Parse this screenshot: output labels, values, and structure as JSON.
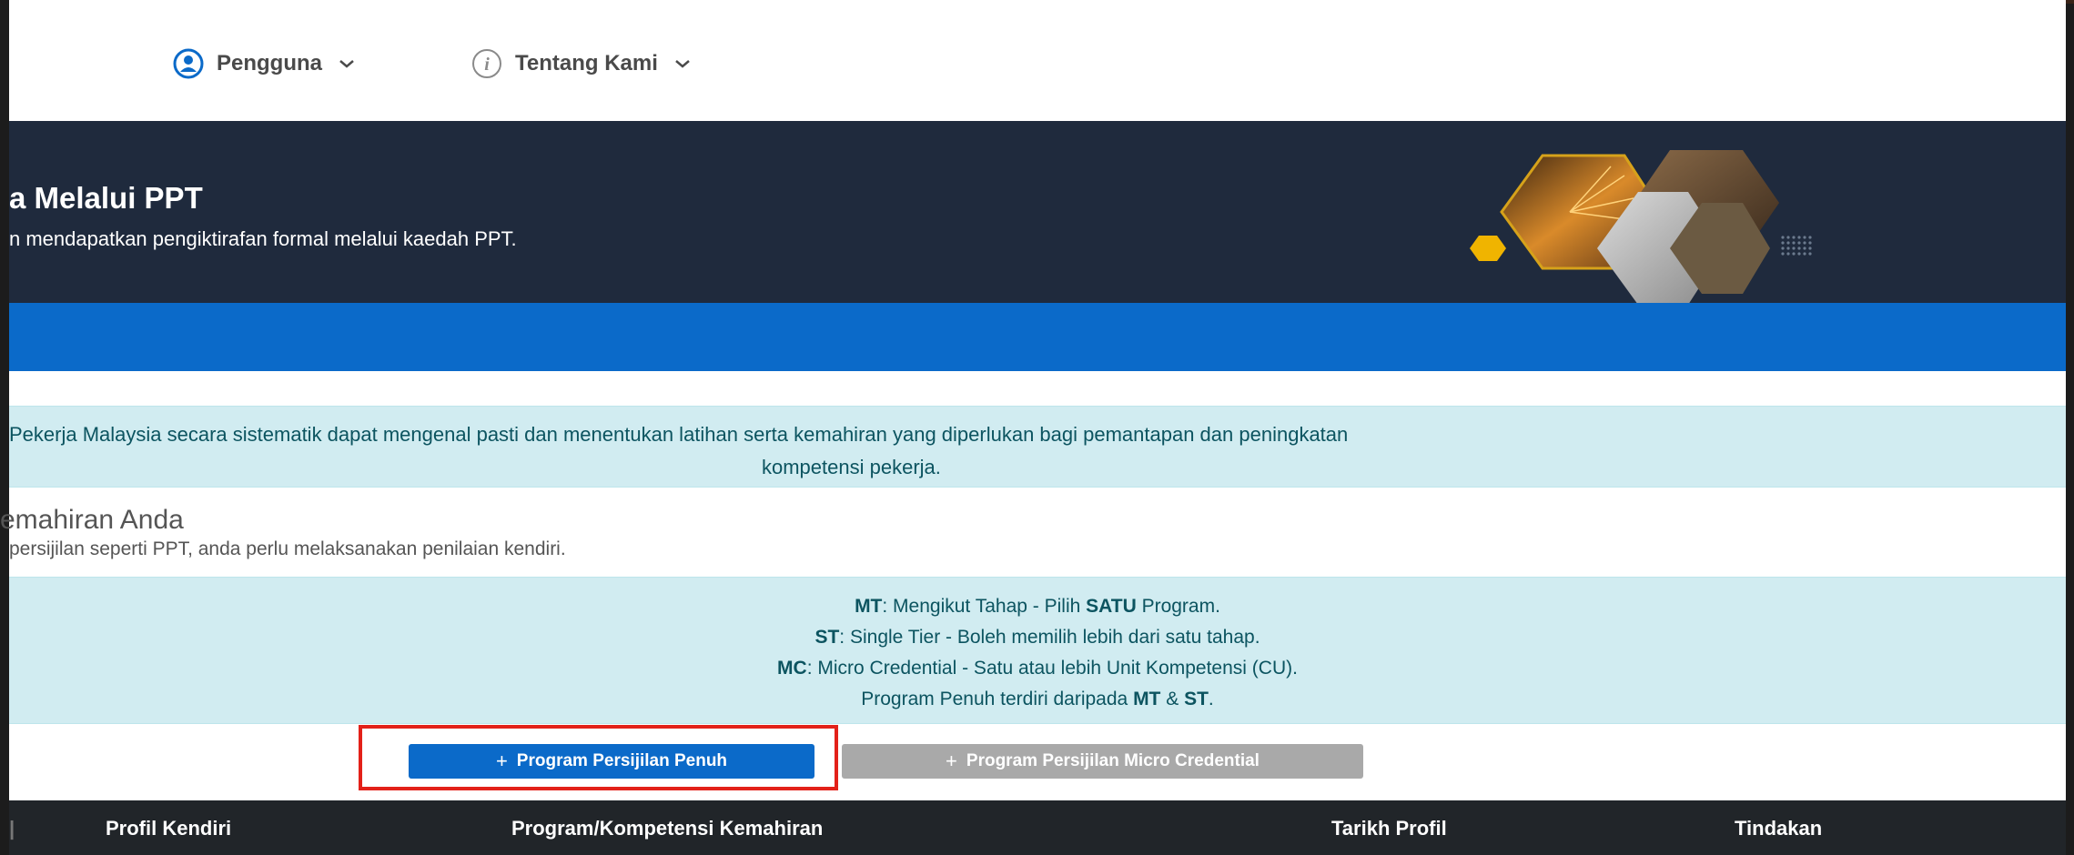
{
  "nav": {
    "user_label": "Pengguna",
    "about_label": "Tentang Kami"
  },
  "hero": {
    "title": "a Melalui PPT",
    "subtitle": "n mendapatkan pengiktirafan formal melalui kaedah PPT."
  },
  "info_alert": {
    "line1": "Pekerja Malaysia secara sistematik dapat mengenal pasti dan menentukan latihan serta kemahiran yang diperlukan bagi pemantapan dan peningkatan",
    "line2": "kompetensi pekerja."
  },
  "section": {
    "title": "emahiran Anda",
    "subtitle": "persijilan seperti PPT, anda perlu melaksanakan penilaian kendiri."
  },
  "program_legend": {
    "mt_code": "MT",
    "mt_text_a": ": Mengikut Tahap - Pilih ",
    "mt_emph": "SATU",
    "mt_text_b": " Program.",
    "st_code": "ST",
    "st_text": ": Single Tier - Boleh memilih lebih dari satu tahap.",
    "mc_code": "MC",
    "mc_text": ": Micro Credential - Satu atau lebih Unit Kompetensi (CU).",
    "full_text_a": "Program Penuh terdiri daripada ",
    "full_mt": "MT",
    "full_amp": " & ",
    "full_st": "ST",
    "full_dot": "."
  },
  "buttons": {
    "plus": "+",
    "full_program": "Program Persijilan Penuh",
    "micro_program": "Program Persijilan Micro Credential"
  },
  "table": {
    "columns": [
      "|",
      "Profil Kendiri",
      "Program/Kompetensi Kemahiran",
      "Tarikh Profil",
      "Tindakan"
    ]
  },
  "colors": {
    "primary": "#0b6ac9",
    "dark": "#1f2a3d",
    "info_bg": "#d1ecf1",
    "info_text": "#0c5460",
    "highlight": "#e32119",
    "secondary_button": "#a9a9a9"
  },
  "icons": {
    "user": "user-circle-icon",
    "about": "info-circle-icon",
    "dropdown": "chevron-down-icon"
  }
}
